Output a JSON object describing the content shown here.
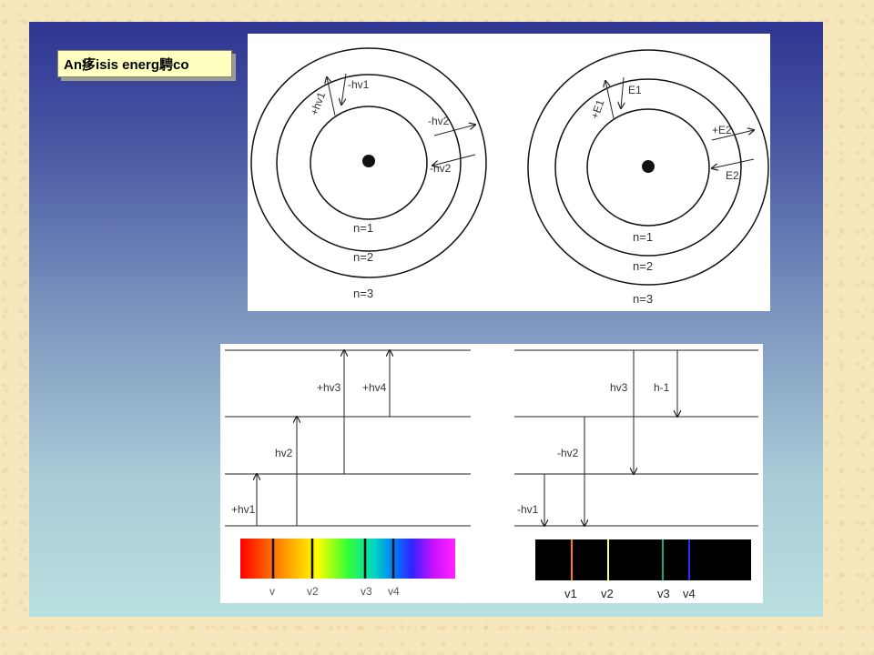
{
  "title": "An痑isis energ騁co",
  "atoms": {
    "left": {
      "inner_out_label": "+hv1",
      "inner_in_label": "-hv1",
      "outer_out_label": "-hv2",
      "outer_in_label": "-hv2"
    },
    "right": {
      "inner_out_label": "+E1",
      "inner_in_label": "E1",
      "outer_out_label": "+E2",
      "outer_in_label": "E2"
    },
    "shell_labels": [
      "n=1",
      "n=2",
      "n=3"
    ]
  },
  "levels": {
    "absorption": {
      "arrow_labels": [
        "+hv1",
        "hv2",
        "+hv3",
        "+hv4"
      ]
    },
    "emission": {
      "arrow_labels": [
        "-hv1",
        "-hv2",
        "hv3",
        "h-1"
      ]
    }
  },
  "spectra": {
    "absorption_labels": [
      "v",
      "v2",
      "v3",
      "v4"
    ],
    "emission_labels": [
      "v1",
      "v2",
      "v3",
      "v4"
    ],
    "emission_line_colors": [
      "#ff7a1a",
      "#ffff66",
      "#1fa87a",
      "#2a2aff"
    ]
  }
}
